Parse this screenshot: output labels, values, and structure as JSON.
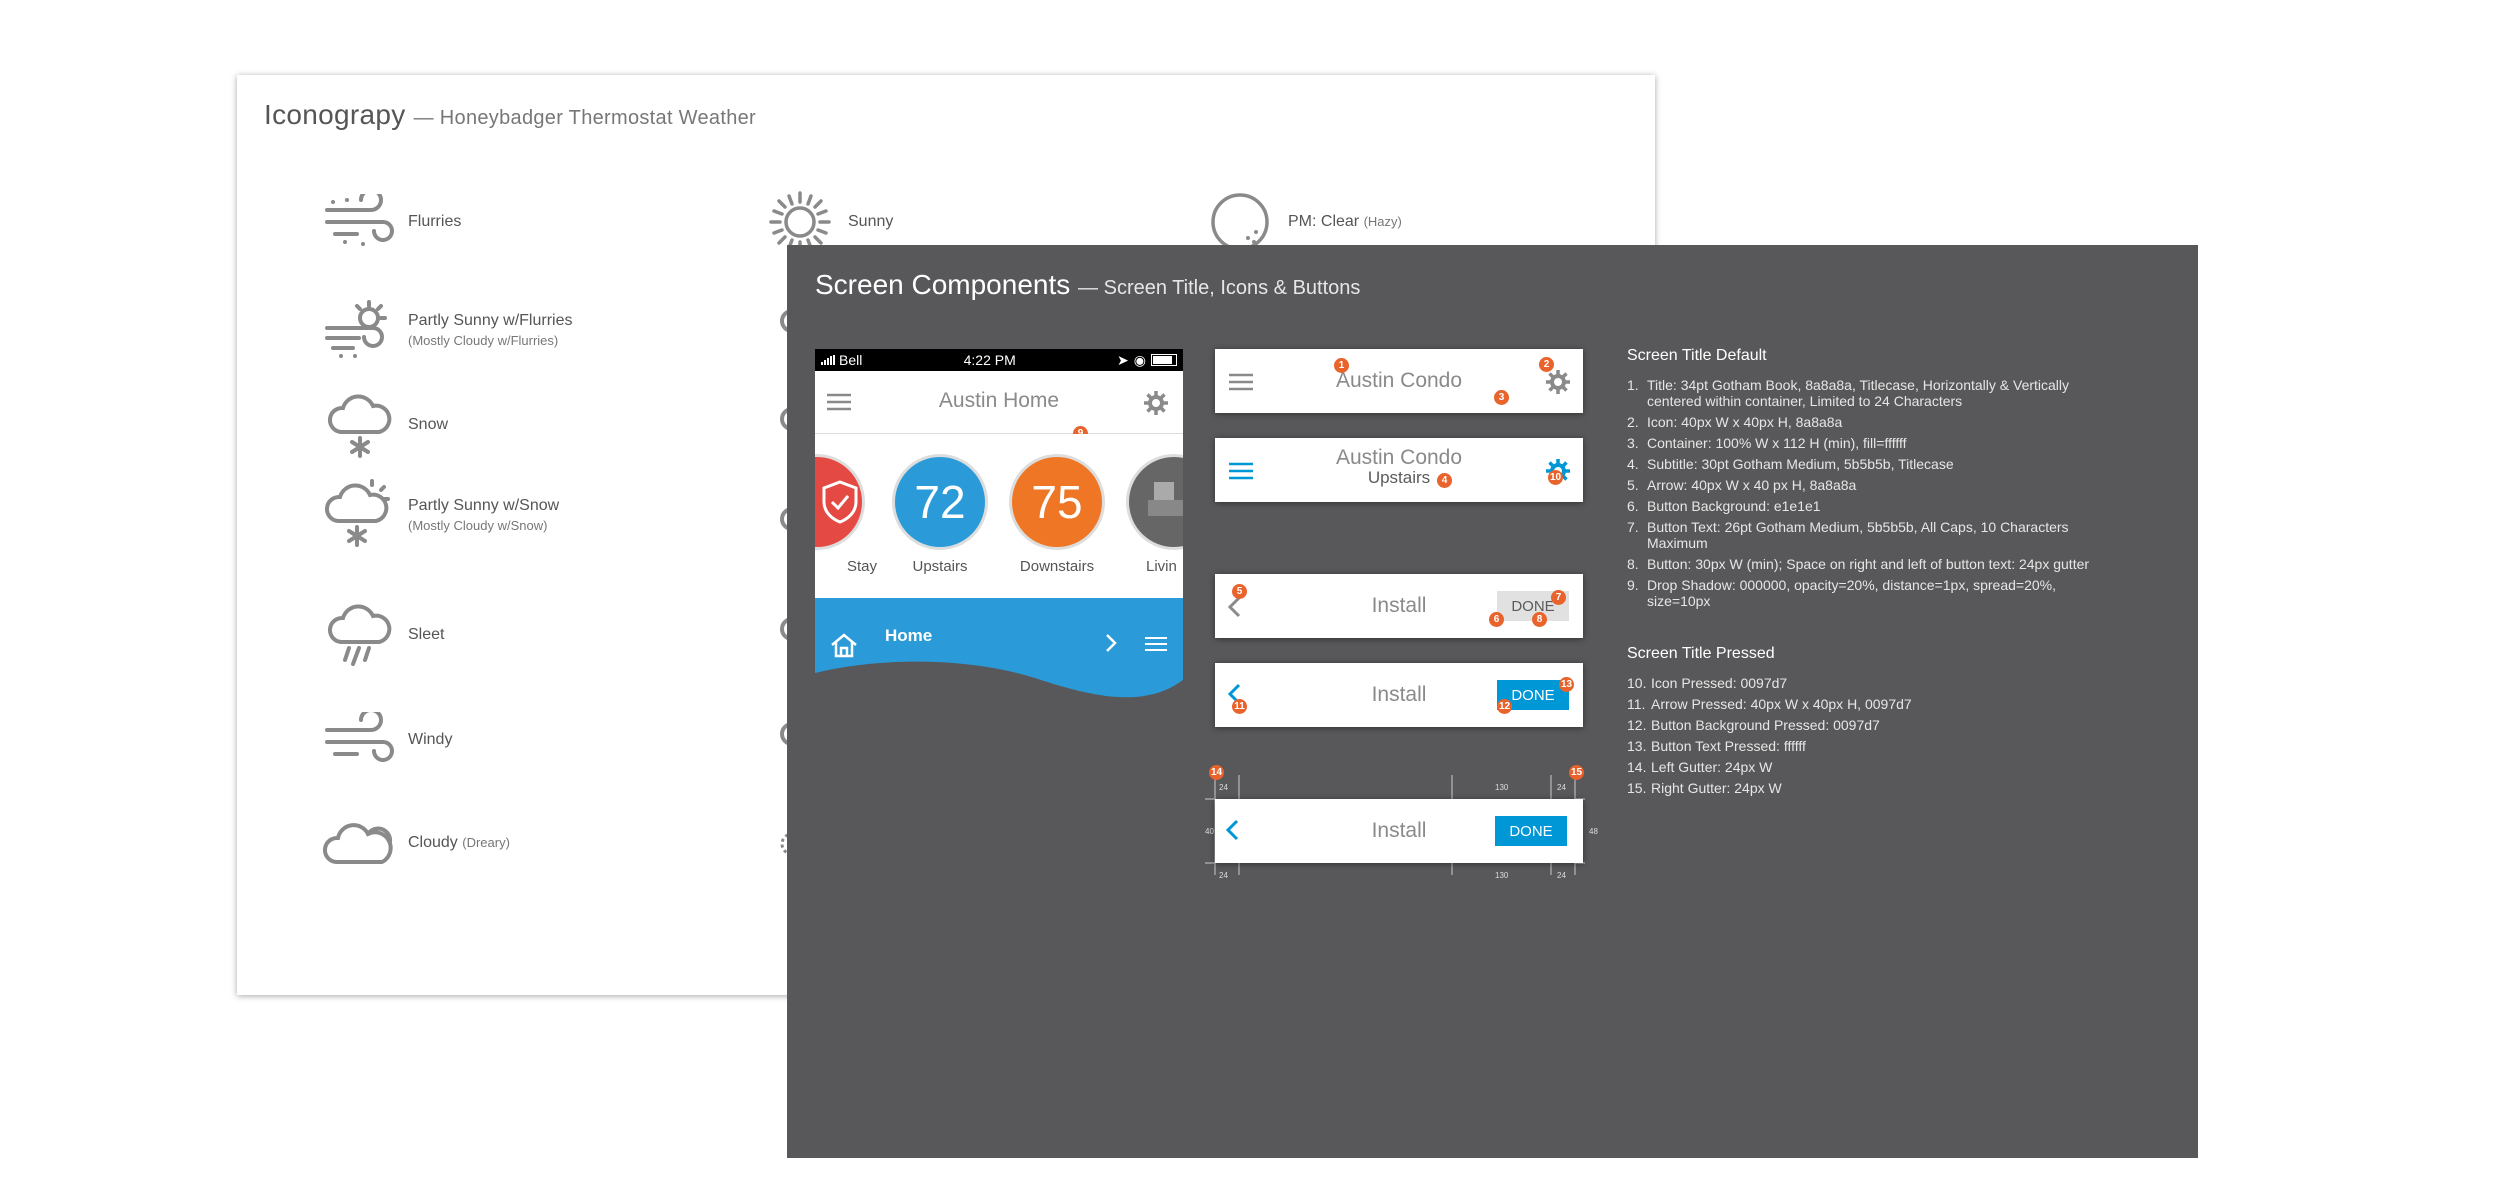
{
  "iconography": {
    "title": "Iconograpy",
    "subtitle": "— Honeybadger Thermostat Weather",
    "col1": [
      {
        "icon": "flurries-icon",
        "name": "Flurries",
        "note": ""
      },
      {
        "icon": "partly-sunny-flurries-icon",
        "name": "Partly Sunny w/Flurries",
        "note": "(Mostly Cloudy w/Flurries)"
      },
      {
        "icon": "snow-icon",
        "name": "Snow",
        "note": ""
      },
      {
        "icon": "partly-sunny-snow-icon",
        "name": "Partly Sunny w/Snow",
        "note": "(Mostly Cloudy w/Snow)"
      },
      {
        "icon": "sleet-icon",
        "name": "Sleet",
        "note": ""
      },
      {
        "icon": "windy-icon",
        "name": "Windy",
        "note": ""
      },
      {
        "icon": "cloudy-icon",
        "name": "Cloudy",
        "inline": "(Dreary)"
      }
    ],
    "col2": [
      {
        "icon": "sunny-icon",
        "name": "Sunny"
      }
    ],
    "col3": [
      {
        "icon": "clear-hazy-icon",
        "name": "PM: Clear",
        "inline": "(Hazy)"
      }
    ]
  },
  "components": {
    "title": "Screen Components",
    "subtitle": "— Screen Title, Icons & Buttons",
    "phone": {
      "carrier": "Bell",
      "time": "4:22 PM",
      "title": "Austin Home",
      "dials": [
        {
          "value": "",
          "label": "Stay",
          "color": "#e44a43"
        },
        {
          "value": "72",
          "label": "Upstairs",
          "color": "#2a9bd8"
        },
        {
          "value": "75",
          "label": "Downstairs",
          "color": "#ee7624"
        },
        {
          "value": "",
          "label": "Livin",
          "color": "#666666"
        }
      ],
      "footer": "Home"
    },
    "cards": {
      "c1_title": "Austin Condo",
      "c2_title": "Austin Condo",
      "c2_sub": "Upstairs",
      "c3_title": "Install",
      "c3_btn": "DONE",
      "c4_title": "Install",
      "c4_btn": "DONE",
      "c5_title": "Install",
      "c5_btn": "DONE"
    },
    "measures": {
      "top_left": "24",
      "top_mid": "130",
      "top_right": "24",
      "left": "40",
      "right": "48",
      "bot_left": "24",
      "bot_mid": "130",
      "bot_right": "24"
    },
    "markers": [
      "1",
      "2",
      "3",
      "4",
      "5",
      "6",
      "7",
      "8",
      "9",
      "10",
      "11",
      "12",
      "13",
      "14",
      "15"
    ],
    "spec_default": {
      "heading": "Screen Title Default",
      "items": [
        {
          "n": "1.",
          "t": "Title: 34pt Gotham Book, 8a8a8a, Titlecase, Horizontally & Vertically centered within container, Limited to 24 Characters"
        },
        {
          "n": "2.",
          "t": "Icon: 40px W x 40px H, 8a8a8a"
        },
        {
          "n": "3.",
          "t": "Container: 100% W x 112 H (min), fill=ffffff"
        },
        {
          "n": "4.",
          "t": "Subtitle: 30pt Gotham Medium, 5b5b5b, Titlecase"
        },
        {
          "n": "5.",
          "t": "Arrow: 40px W x 40 px H, 8a8a8a"
        },
        {
          "n": "6.",
          "t": "Button Background: e1e1e1"
        },
        {
          "n": "7.",
          "t": "Button Text: 26pt Gotham Medium, 5b5b5b, All Caps, 10 Characters Maximum"
        },
        {
          "n": "8.",
          "t": "Button: 30px W (min); Space on right and left of button text: 24px gutter"
        },
        {
          "n": "9.",
          "t": "Drop Shadow: 000000, opacity=20%, distance=1px, spread=20%, size=10px"
        }
      ]
    },
    "spec_pressed": {
      "heading": "Screen Title Pressed",
      "items": [
        {
          "n": "10.",
          "t": "Icon Pressed: 0097d7"
        },
        {
          "n": "11.",
          "t": "Arrow Pressed: 40px W x 40px H, 0097d7"
        },
        {
          "n": "12.",
          "t": "Button Background Pressed: 0097d7"
        },
        {
          "n": "13.",
          "t": "Button Text Pressed: ffffff"
        },
        {
          "n": "14.",
          "t": "Left Gutter: 24px W"
        },
        {
          "n": "15.",
          "t": "Right Gutter: 24px W"
        }
      ]
    },
    "colors": {
      "default": "#8a8a8a",
      "pressed": "#0097d7",
      "button_bg": "#e1e1e1",
      "marker": "#e8642c",
      "panel": "#58585a"
    }
  }
}
